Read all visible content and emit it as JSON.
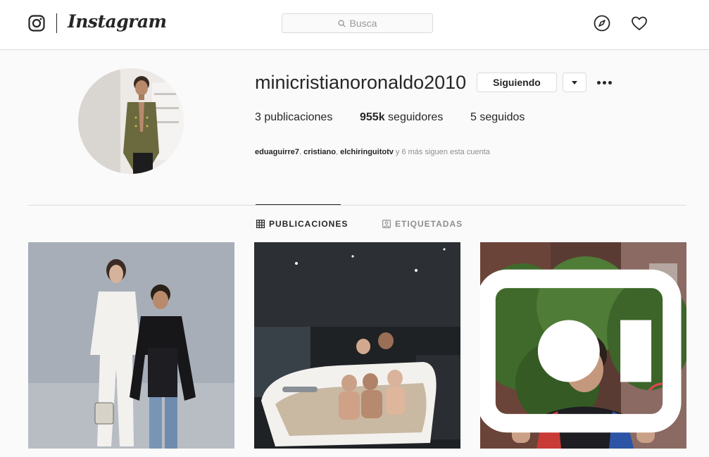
{
  "header": {
    "brand": "Instagram",
    "search_placeholder": "Busca",
    "icons": [
      "instagram-camera-icon",
      "search-icon",
      "explore-compass-icon",
      "activity-heart-icon"
    ]
  },
  "profile": {
    "username": "minicristianoronaldo2010",
    "follow_label": "Siguiendo",
    "stats": {
      "posts_value": "3",
      "posts_label": "publicaciones",
      "followers_value": "955k",
      "followers_label": "seguidores",
      "following_value": "5",
      "following_label": "seguidos"
    },
    "followed_by": {
      "users": [
        "eduaguirre7",
        "cristiano",
        "elchiringuitotv"
      ],
      "sep": ", ",
      "suffix": " y 6 más siguen esta cuenta"
    }
  },
  "tabs": [
    {
      "label": "PUBLICACIONES",
      "icon": "grid-icon",
      "active": true
    },
    {
      "label": "ETIQUETADAS",
      "icon": "tagged-person-icon",
      "active": false
    }
  ],
  "posts": [
    {
      "kind": "photo",
      "subject": "woman-and-boy-portrait"
    },
    {
      "kind": "photo",
      "subject": "family-in-bathtub"
    },
    {
      "kind": "video",
      "subject": "boy-thumbs-up",
      "badge_icon": "igtv-icon"
    }
  ],
  "colors": {
    "text": "#262626",
    "muted": "#8e8e8e",
    "border": "#dbdbdb",
    "background": "#fafafa"
  }
}
